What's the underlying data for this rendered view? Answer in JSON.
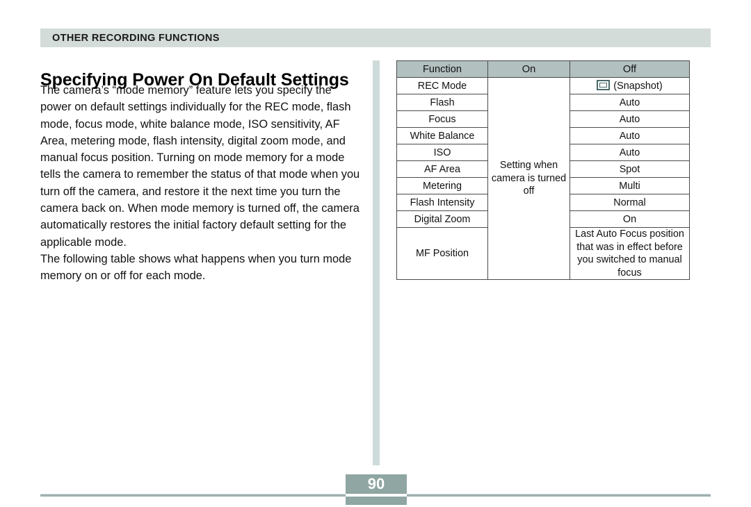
{
  "section_header": {
    "label": "OTHER RECORDING FUNCTIONS",
    "bg_color": "#d4dcd9"
  },
  "page_title": "Specifying Power On Default Settings",
  "body_copy": {
    "paragraph_1": "The camera’s “mode memory” feature lets you specify the power on default settings individually for the REC mode, flash mode, focus mode, white balance mode, ISO sensitivity, AF Area, metering mode, flash intensity, digital zoom mode, and manual focus position. Turning on mode memory for a mode tells the camera to remember the status of that mode when you turn off the camera, and restore it the next time you turn the camera back on. When mode memory is turned off, the camera automatically restores the initial factory default setting for the applicable mode.",
    "paragraph_2": "The following table shows what happens when you turn mode memory on or off for each mode."
  },
  "settings_table": {
    "header_bg_color": "#b2c0bf",
    "columns": [
      "Function",
      "On",
      "Off"
    ],
    "on_merged_value": "Setting when camera is turned off",
    "rows": [
      {
        "function": "REC Mode",
        "off": "(Snapshot)",
        "off_icon": "snapshot-icon"
      },
      {
        "function": "Flash",
        "off": "Auto"
      },
      {
        "function": "Focus",
        "off": "Auto"
      },
      {
        "function": "White Balance",
        "off": "Auto"
      },
      {
        "function": "ISO",
        "off": "Auto"
      },
      {
        "function": "AF Area",
        "off": "Spot"
      },
      {
        "function": "Metering",
        "off": "Multi"
      },
      {
        "function": "Flash Intensity",
        "off": "Normal"
      },
      {
        "function": "Digital Zoom",
        "off": "On"
      },
      {
        "function": "MF Position",
        "off": "Last Auto Focus position that was in effect before you switched to manual focus"
      }
    ]
  },
  "footer": {
    "page_number": "90",
    "page_number_bg_color": "#8fa6a3"
  }
}
